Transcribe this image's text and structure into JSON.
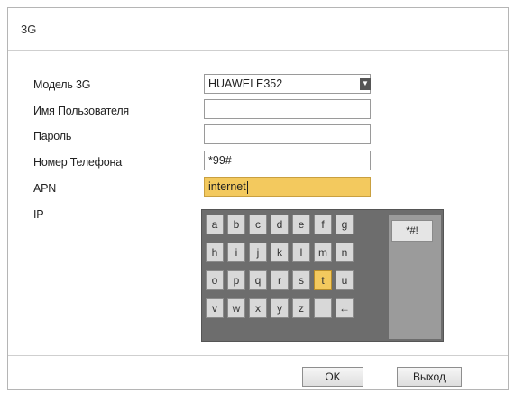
{
  "dialog": {
    "title": "3G"
  },
  "form": {
    "model_label": "Модель 3G",
    "model_value": "HUAWEI E352",
    "username_label": "Имя Пользователя",
    "username_value": "",
    "password_label": "Пароль",
    "password_value": "",
    "phone_label": "Номер Телефона",
    "phone_value": "*99#",
    "apn_label": "APN",
    "apn_value": "internet",
    "ip_label": "IP"
  },
  "keyboard": {
    "rows": [
      [
        "a",
        "b",
        "c",
        "d",
        "e",
        "f",
        "g"
      ],
      [
        "h",
        "i",
        "j",
        "k",
        "l",
        "m",
        "n"
      ],
      [
        "o",
        "p",
        "q",
        "r",
        "s",
        "t",
        "u"
      ],
      [
        "v",
        "w",
        "x",
        "y",
        "z",
        "",
        "←"
      ]
    ],
    "highlighted_key": "t",
    "symbol_key": "*#!"
  },
  "footer": {
    "ok_label": "OK",
    "exit_label": "Выход"
  },
  "colors": {
    "active_field": "#f3c95e",
    "keyboard_bg": "#6d6d6d"
  }
}
